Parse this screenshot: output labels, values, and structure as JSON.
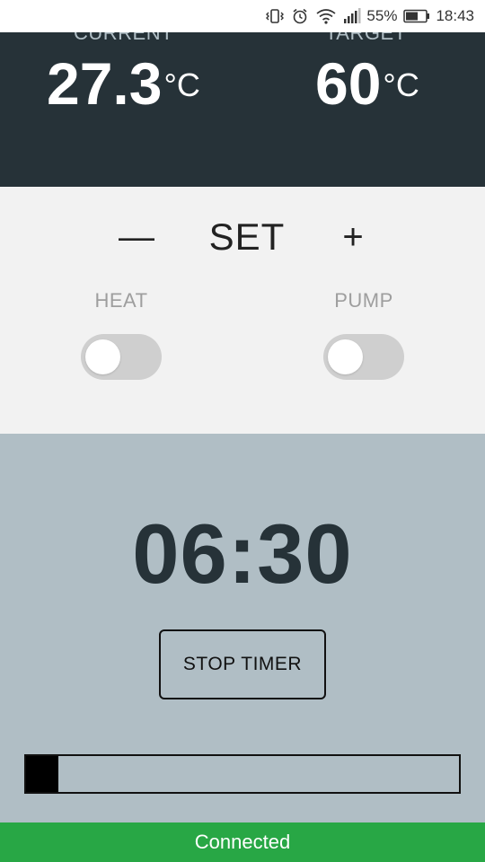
{
  "status_bar": {
    "icons": [
      "vibrate-icon",
      "alarm-icon",
      "wifi-icon",
      "signal-icon",
      "battery-icon"
    ],
    "battery_percent": "55%",
    "time": "18:43"
  },
  "temperature": {
    "current_label": "CURRENT",
    "current_value": "27.3",
    "current_unit": "°C",
    "target_label": "TARGET",
    "target_value": "60",
    "target_unit": "°C"
  },
  "controls": {
    "minus_label": "—",
    "set_label": "SET",
    "plus_label": "+",
    "heat_label": "HEAT",
    "pump_label": "PUMP",
    "heat_on": false,
    "pump_on": false
  },
  "timer": {
    "display": "06:30",
    "stop_label": "STOP TIMER",
    "progress_fraction": 0.075
  },
  "connection": {
    "status_text": "Connected"
  },
  "colors": {
    "header_bg": "#263238",
    "timer_bg": "#b0bec5",
    "connected_green": "#28a745"
  }
}
